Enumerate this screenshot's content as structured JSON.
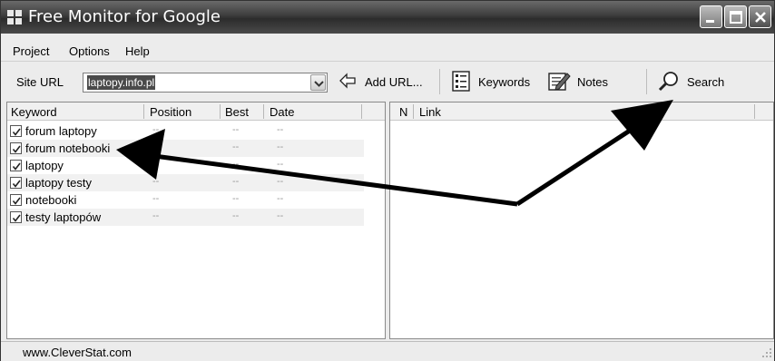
{
  "window": {
    "title": "Free Monitor for Google"
  },
  "menu": [
    "Project",
    "Options",
    "Help"
  ],
  "toolbar": {
    "site_url_label": "Site URL",
    "site_url_value": "laptopy.info.pl",
    "add_url_label": "Add URL...",
    "keywords_label": "Keywords",
    "notes_label": "Notes",
    "search_label": "Search"
  },
  "keywords_table": {
    "columns": [
      "Keyword",
      "Position",
      "Best",
      "Date"
    ],
    "rows": [
      {
        "keyword": "forum laptopy",
        "checked": true,
        "position": "--",
        "best": "--",
        "date": "--"
      },
      {
        "keyword": "forum notebooki",
        "checked": true,
        "position": "--",
        "best": "--",
        "date": "--"
      },
      {
        "keyword": "laptopy",
        "checked": true,
        "position": "--",
        "best": "--",
        "date": "--"
      },
      {
        "keyword": "laptopy testy",
        "checked": true,
        "position": "--",
        "best": "--",
        "date": "--"
      },
      {
        "keyword": "notebooki",
        "checked": true,
        "position": "--",
        "best": "--",
        "date": "--"
      },
      {
        "keyword": "testy laptopów",
        "checked": true,
        "position": "--",
        "best": "--",
        "date": "--"
      }
    ]
  },
  "links_table": {
    "columns": [
      "N",
      "Link"
    ]
  },
  "status": {
    "text": "www.CleverStat.com"
  },
  "annotation_color": "#000000"
}
